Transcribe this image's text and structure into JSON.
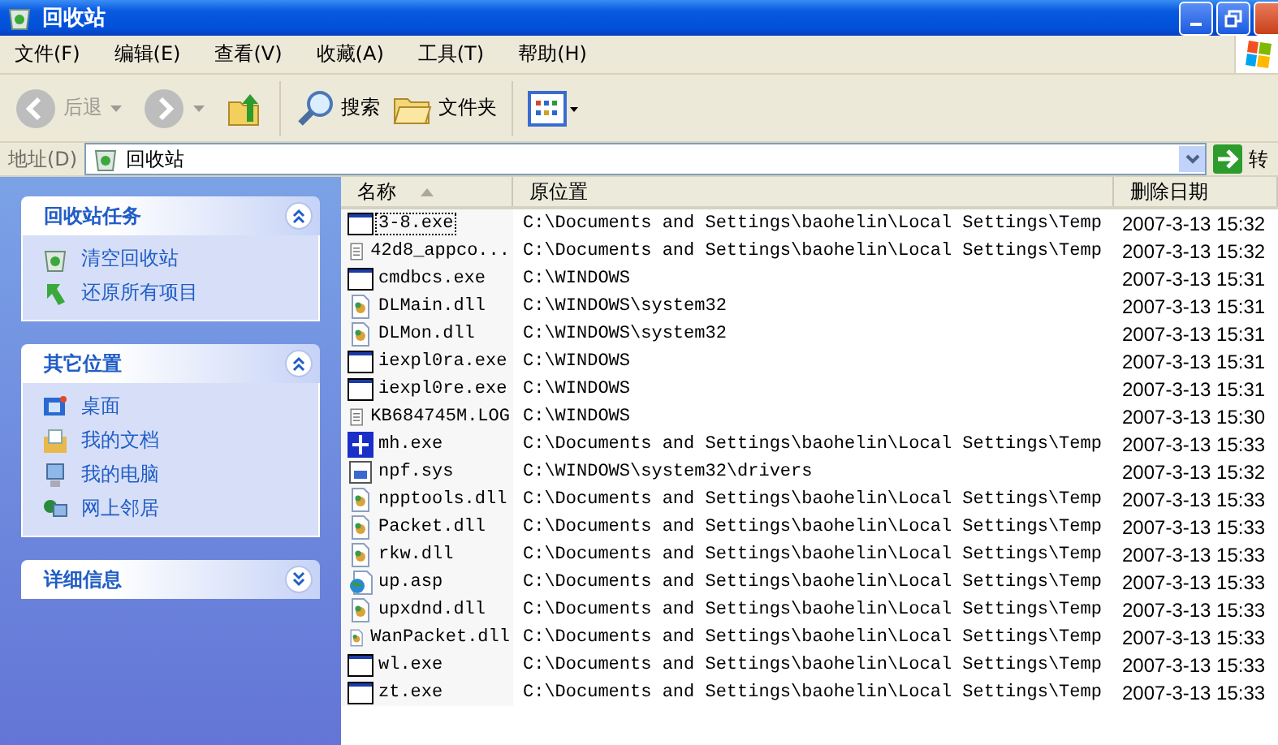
{
  "window": {
    "title": "回收站"
  },
  "menu": [
    "文件(F)",
    "编辑(E)",
    "查看(V)",
    "收藏(A)",
    "工具(T)",
    "帮助(H)"
  ],
  "toolbar": {
    "back": {
      "label": "后退",
      "disabled": true
    },
    "forward": {
      "disabled": true
    },
    "search": "搜索",
    "folders": "文件夹"
  },
  "address": {
    "label": "地址(D)",
    "value": "回收站",
    "go": "转"
  },
  "sidebar": [
    {
      "title": "回收站任务",
      "expanded": true,
      "items": [
        {
          "kind": "bin",
          "label": "清空回收站"
        },
        {
          "kind": "restore",
          "label": "还原所有项目"
        }
      ]
    },
    {
      "title": "其它位置",
      "expanded": true,
      "items": [
        {
          "kind": "desktop",
          "label": "桌面"
        },
        {
          "kind": "documents",
          "label": "我的文档"
        },
        {
          "kind": "computer",
          "label": "我的电脑"
        },
        {
          "kind": "network",
          "label": "网上邻居"
        }
      ]
    },
    {
      "title": "详细信息",
      "expanded": false
    }
  ],
  "table": {
    "columns": [
      {
        "label": "名称",
        "sorted": true
      },
      {
        "label": "原位置",
        "sorted": false
      },
      {
        "label": "删除日期",
        "sorted": false
      }
    ],
    "rows": [
      {
        "kind": "exe",
        "name": "3-8.exe",
        "location": "C:\\Documents and Settings\\baohelin\\Local Settings\\Temp",
        "deleted": "2007-3-13 15:32",
        "focused": true
      },
      {
        "kind": "text",
        "name": "42d8_appco...",
        "location": "C:\\Documents and Settings\\baohelin\\Local Settings\\Temp",
        "deleted": "2007-3-13 15:32",
        "focused": false
      },
      {
        "kind": "exe",
        "name": "cmdbcs.exe",
        "location": "C:\\WINDOWS",
        "deleted": "2007-3-13 15:31",
        "focused": false
      },
      {
        "kind": "dll",
        "name": "DLMain.dll",
        "location": "C:\\WINDOWS\\system32",
        "deleted": "2007-3-13 15:31",
        "focused": false
      },
      {
        "kind": "dll",
        "name": "DLMon.dll",
        "location": "C:\\WINDOWS\\system32",
        "deleted": "2007-3-13 15:31",
        "focused": false
      },
      {
        "kind": "exe",
        "name": "iexpl0ra.exe",
        "location": "C:\\WINDOWS",
        "deleted": "2007-3-13 15:31",
        "focused": false
      },
      {
        "kind": "exe",
        "name": "iexpl0re.exe",
        "location": "C:\\WINDOWS",
        "deleted": "2007-3-13 15:31",
        "focused": false
      },
      {
        "kind": "text",
        "name": "KB684745M.LOG",
        "location": "C:\\WINDOWS",
        "deleted": "2007-3-13 15:30",
        "focused": false
      },
      {
        "kind": "app",
        "name": "mh.exe",
        "location": "C:\\Documents and Settings\\baohelin\\Local Settings\\Temp",
        "deleted": "2007-3-13 15:33",
        "focused": false
      },
      {
        "kind": "sys",
        "name": "npf.sys",
        "location": "C:\\WINDOWS\\system32\\drivers",
        "deleted": "2007-3-13 15:32",
        "focused": false
      },
      {
        "kind": "dll",
        "name": "npptools.dll",
        "location": "C:\\Documents and Settings\\baohelin\\Local Settings\\Temp",
        "deleted": "2007-3-13 15:33",
        "focused": false
      },
      {
        "kind": "dll",
        "name": "Packet.dll",
        "location": "C:\\Documents and Settings\\baohelin\\Local Settings\\Temp",
        "deleted": "2007-3-13 15:33",
        "focused": false
      },
      {
        "kind": "dll",
        "name": "rkw.dll",
        "location": "C:\\Documents and Settings\\baohelin\\Local Settings\\Temp",
        "deleted": "2007-3-13 15:33",
        "focused": false
      },
      {
        "kind": "web",
        "name": "up.asp",
        "location": "C:\\Documents and Settings\\baohelin\\Local Settings\\Temp",
        "deleted": "2007-3-13 15:33",
        "focused": false
      },
      {
        "kind": "dll",
        "name": "upxdnd.dll",
        "location": "C:\\Documents and Settings\\baohelin\\Local Settings\\Temp",
        "deleted": "2007-3-13 15:33",
        "focused": false
      },
      {
        "kind": "dll",
        "name": "WanPacket.dll",
        "location": "C:\\Documents and Settings\\baohelin\\Local Settings\\Temp",
        "deleted": "2007-3-13 15:33",
        "focused": false
      },
      {
        "kind": "exe",
        "name": "wl.exe",
        "location": "C:\\Documents and Settings\\baohelin\\Local Settings\\Temp",
        "deleted": "2007-3-13 15:33",
        "focused": false
      },
      {
        "kind": "exe",
        "name": "zt.exe",
        "location": "C:\\Documents and Settings\\baohelin\\Local Settings\\Temp",
        "deleted": "2007-3-13 15:33",
        "focused": false
      }
    ]
  }
}
